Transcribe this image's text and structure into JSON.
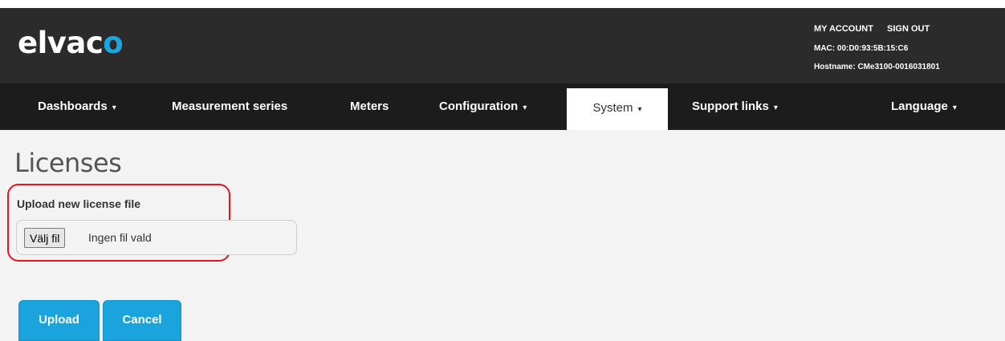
{
  "brand": {
    "logo_text": "elvac",
    "logo_accent": "o",
    "accent_color": "#1aa7e0"
  },
  "header": {
    "my_account": "MY ACCOUNT",
    "sign_out": "SIGN OUT",
    "mac": "MAC: 00:D0:93:5B:15:C6",
    "hostname": "Hostname: CMe3100-0016031801"
  },
  "nav": {
    "items": [
      {
        "label": "Dashboards",
        "caret": "▾"
      },
      {
        "label": "Measurement series",
        "caret": ""
      },
      {
        "label": "Meters",
        "caret": ""
      },
      {
        "label": "Configuration",
        "caret": "▾"
      },
      {
        "label": "System",
        "caret": "▾",
        "active": true
      },
      {
        "label": "Support links",
        "caret": "▾"
      },
      {
        "label": "Language",
        "caret": "▾"
      }
    ]
  },
  "main": {
    "title": "Licenses",
    "upload_label": "Upload new license file",
    "file_button": "Välj fil",
    "file_status": "Ingen fil vald",
    "upload_button": "Upload",
    "cancel_button": "Cancel",
    "highlight_color": "#e3161f"
  }
}
